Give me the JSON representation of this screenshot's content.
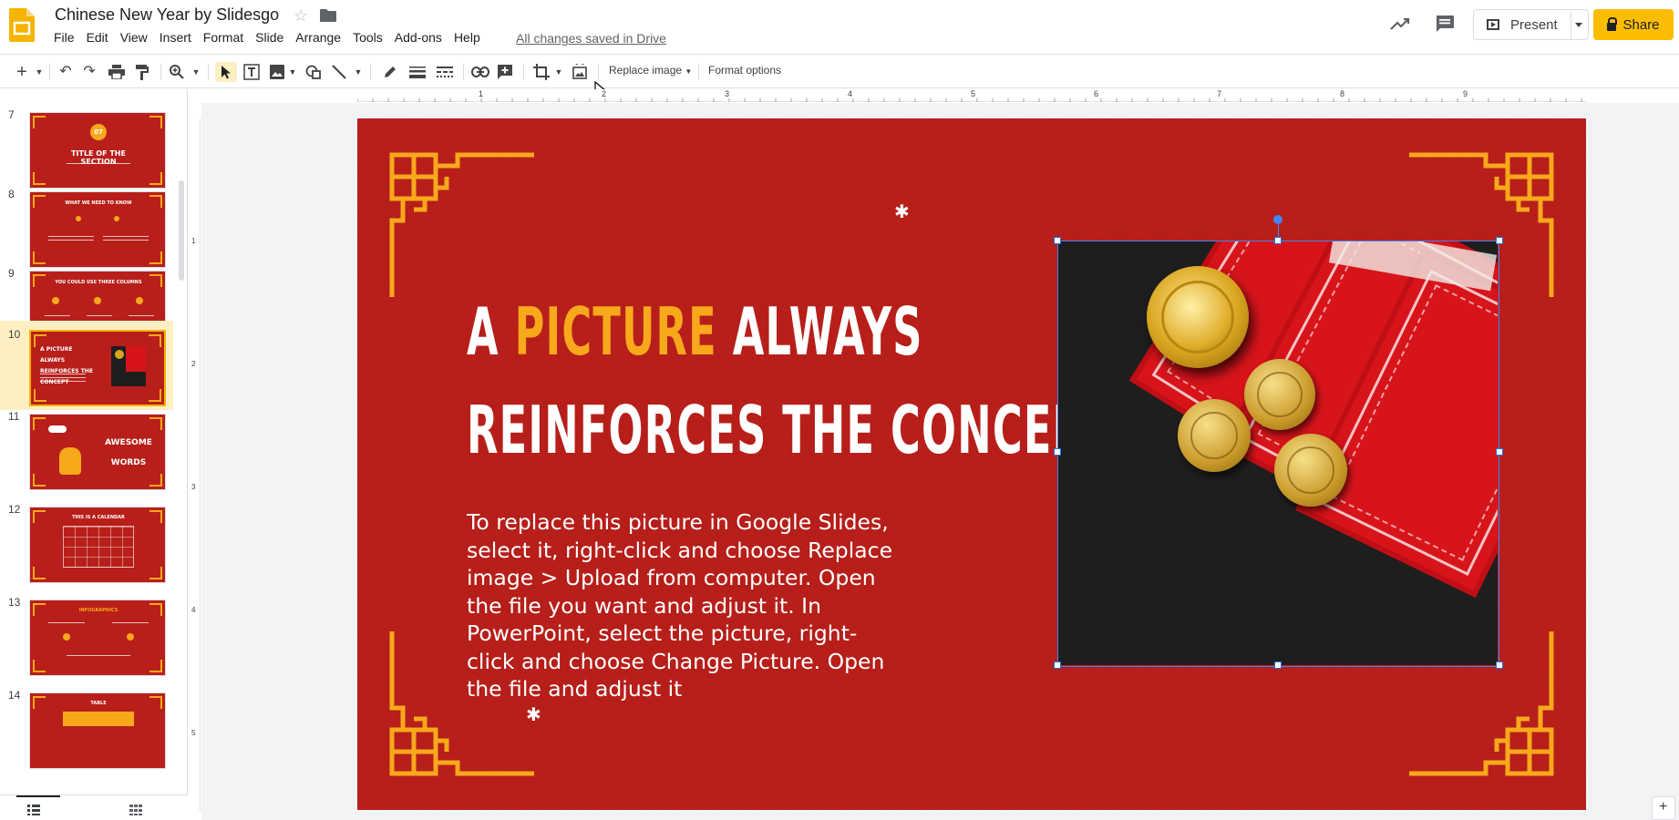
{
  "app": {
    "title": "Chinese New Year by Slidesgo",
    "saved_status": "All changes saved in Drive"
  },
  "menu": [
    "File",
    "Edit",
    "View",
    "Insert",
    "Format",
    "Slide",
    "Arrange",
    "Tools",
    "Add-ons",
    "Help"
  ],
  "header": {
    "present_label": "Present",
    "share_label": "Share"
  },
  "toolbar": {
    "replace_image_label": "Replace image",
    "format_options_label": "Format options"
  },
  "ruler": {
    "top_labels": [
      "1",
      "2",
      "3",
      "4",
      "5",
      "6",
      "7",
      "8",
      "9"
    ],
    "left_labels": [
      "1",
      "2",
      "3",
      "4",
      "5"
    ]
  },
  "slides_panel": {
    "slides": [
      {
        "number": "7",
        "title": "TITLE OF THE SECTION",
        "badge": "07"
      },
      {
        "number": "8",
        "title": "WHAT WE NEED TO KNOW"
      },
      {
        "number": "9",
        "title": "YOU COULD USE THREE COLUMNS"
      },
      {
        "number": "10",
        "title": "A PICTURE ALWAYS REINFORCES THE CONCEPT",
        "selected": true
      },
      {
        "number": "11",
        "title": "AWESOME WORDS"
      },
      {
        "number": "12",
        "title": "THIS IS A CALENDAR"
      },
      {
        "number": "13",
        "title": "INFOGRAPHICS"
      },
      {
        "number": "14",
        "title": "TABLE"
      }
    ]
  },
  "slide": {
    "title_part1": "A ",
    "title_accent": "PICTURE",
    "title_part2": " ALWAYS",
    "title_line2": "REINFORCES THE CONCEPT",
    "body": "To replace this picture in Google Slides, select it, right-click and choose Replace image > Upload from computer. Open the file you want and adjust it. In PowerPoint, select the picture, right-click and choose Change Picture. Open the file and adjust it"
  },
  "colors": {
    "slide_red": "#b81f1a",
    "accent_gold": "#f7a81b",
    "share_yellow": "#fbbc04",
    "selection_blue": "#4285f4"
  }
}
